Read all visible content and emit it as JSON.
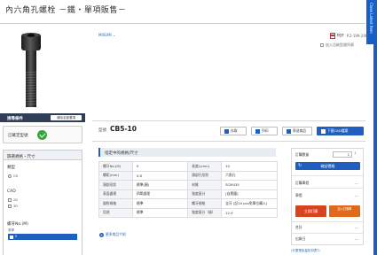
{
  "page": {
    "title": "內六角孔螺栓 －鐵・單項販售－",
    "side_tab": "Close Latest Item"
  },
  "product": {
    "brand": "MISUMI",
    "pdf_label": "PDF",
    "pdf_page": "P.2-199-200",
    "compare_label": "加入比較型號列表"
  },
  "left_panel": {
    "header": "搜尋條件",
    "clear_button": "清除全部選項",
    "selected_label": "已確定型號",
    "filter_header": "篩選規格・尺寸",
    "type_title": "類型",
    "type_options": [
      "CB"
    ],
    "cad_title": "CAD",
    "cad_options": [
      "2D",
      "3D"
    ],
    "size_title": "螺牙No.(M)",
    "size_hint": "選擇",
    "size_selected": "5"
  },
  "main": {
    "model_label": "型號",
    "model_value": "CB5-10",
    "buttons": {
      "save": "存取",
      "print": "列印",
      "share": "寄送商品",
      "cad": "下載CAD檔案"
    },
    "spec_title": "指定中的規格/尺寸",
    "spec_rows": [
      [
        "螺牙No.(M)",
        "5",
        "長度L(mm)",
        "10"
      ],
      [
        "螺距(mm)",
        "0.8",
        "頭部孔形狀",
        "六角孔"
      ],
      [
        "頭部形狀",
        "標準(圓)",
        "材質",
        "SCM435"
      ],
      [
        "表面處理",
        "四氧處理",
        "強度區分",
        "[自黑鐵]"
      ],
      [
        "鎖附規格",
        "標準",
        "螺牙規格",
        "全牙 (記10 pcs免單位購入)"
      ],
      [
        "用途",
        "標準",
        "強度區分（級）",
        "12.9"
      ]
    ],
    "more_link": "更多商品介紹"
  },
  "order": {
    "qty_label": "訂購數量",
    "qty_value": "1",
    "confirm_button": "確認價格",
    "rows": [
      {
        "k": "訂購單價",
        "v": "---"
      },
      {
        "k": "單價",
        "v": "---"
      },
      {
        "k": "合計",
        "v": "---"
      },
      {
        "k": "出貨日",
        "v": "---"
      }
    ],
    "buy_now": "立即訂購",
    "add_cart": "加入訂購車",
    "note": "(什麼是批量折扣表?)"
  }
}
